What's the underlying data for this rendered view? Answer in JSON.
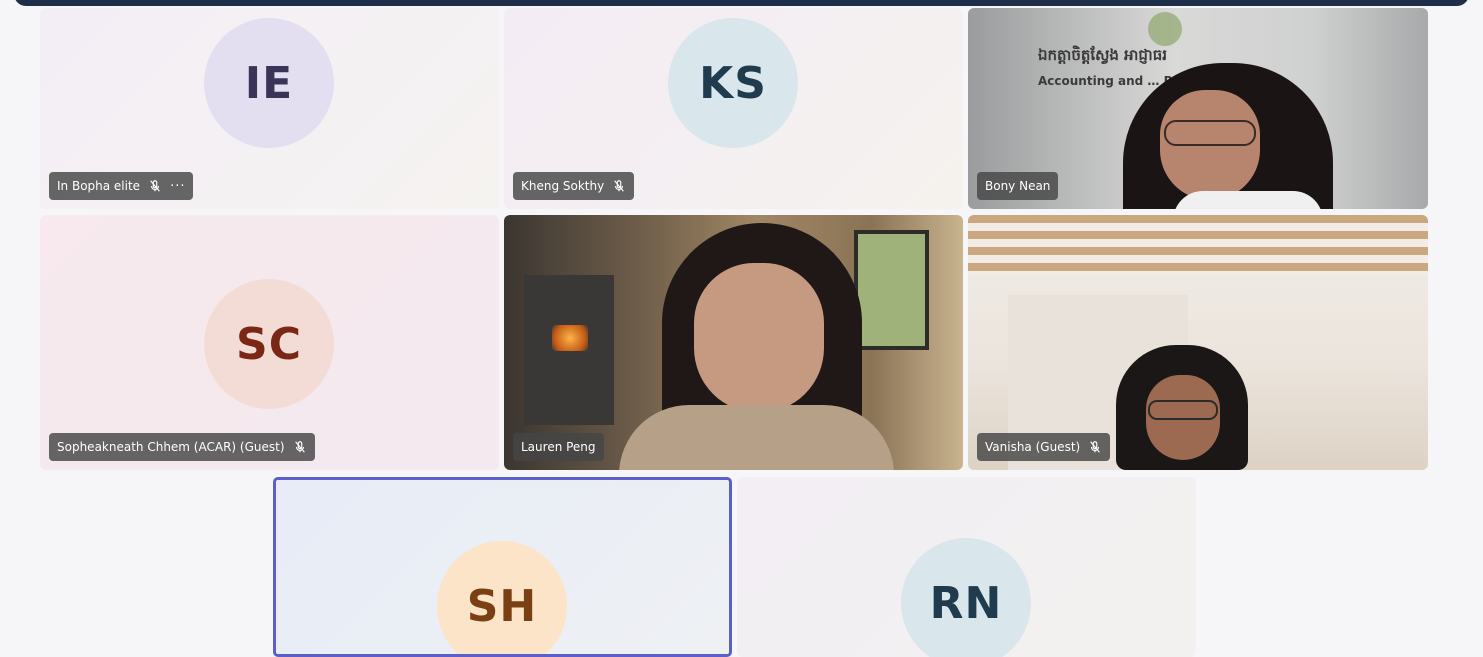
{
  "participants": {
    "ie": {
      "initials": "IE",
      "name": "In Bopha elite",
      "more": "···"
    },
    "ks": {
      "initials": "KS",
      "name": "Kheng Sokthy"
    },
    "bn": {
      "name": "Bony Nean",
      "sign_top": "ឯកត្តាចិត្តស្វែង អាជ្ញាធរ",
      "sign_bottom": "Accounting and … Regulator"
    },
    "sc": {
      "initials": "SC",
      "name": "Sopheakneath Chhem (ACAR) (Guest)"
    },
    "lp": {
      "name": "Lauren Peng"
    },
    "vg": {
      "name": "Vanisha (Guest)"
    },
    "sh": {
      "initials": "SH"
    },
    "rn": {
      "initials": "RN"
    }
  },
  "icons": {
    "mic_off": "mic-off-icon",
    "more": "more-options-icon"
  }
}
